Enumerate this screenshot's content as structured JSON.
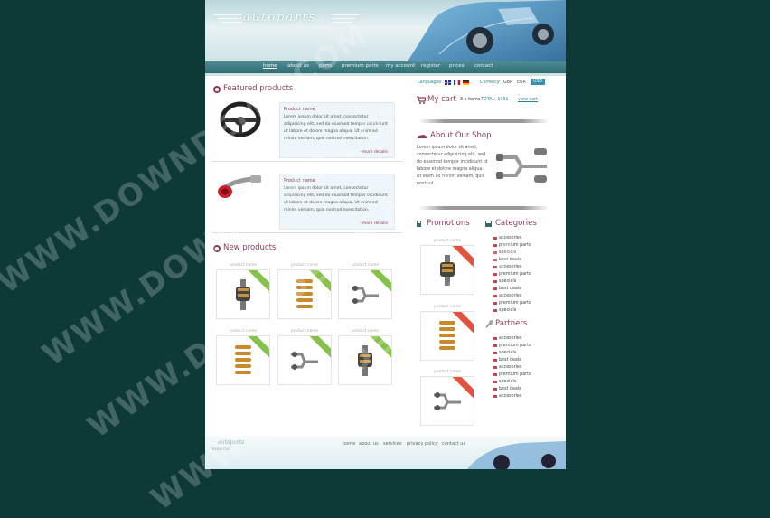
{
  "header": {
    "logo_text": "autoparts"
  },
  "nav": {
    "items": [
      "home",
      "about us",
      "parts",
      "premium parts",
      "my account",
      "register",
      "prices",
      "contact"
    ]
  },
  "featured": {
    "title": "Featured products",
    "products": [
      {
        "name": "Product name",
        "desc": "Lorem ipsum dolor sit amet, consectetur adipisicing elit, sed do eiusmod tempor incididunt ut labore et dolore magna aliqua. Ut enim ad minim veniam, quis nostrud exercitation.",
        "more": "- more details -"
      },
      {
        "name": "Product name",
        "desc": "Lorem ipsum dolor sit amet, consectetur adipisicing elit, sed do eiusmod tempor incididunt ut labore et dolore magna aliqua. Ut enim ad minim veniam, quis nostrud exercitation.",
        "more": "- more details -"
      }
    ]
  },
  "new_products": {
    "title": "New products",
    "items": [
      {
        "caption": "product name",
        "badge": "NEW",
        "icon": "coilover-icon"
      },
      {
        "caption": "product name",
        "badge": "NEW",
        "icon": "spring-icon"
      },
      {
        "caption": "product name",
        "badge": "NEW",
        "icon": "exhaust-icon"
      },
      {
        "caption": "product name",
        "badge": "NEW",
        "icon": "spring-icon"
      },
      {
        "caption": "product name",
        "badge": "NEW",
        "icon": "exhaust-icon"
      },
      {
        "caption": "product name",
        "badge": "NEW",
        "icon": "coilover-icon"
      }
    ]
  },
  "languages": {
    "label": "Languages:"
  },
  "currency": {
    "label": "Currency:",
    "options": [
      "GBP",
      "EUR",
      "USD"
    ],
    "selected": "USD"
  },
  "cart": {
    "title": "My cart",
    "items": "3 x items",
    "total": "TOTAL: 100$",
    "view": "view cart"
  },
  "about": {
    "title": "About Our Shop",
    "text": "Lorem ipsum dolor sit amet, consectetur adipisicing elit, sed do eiusmod tempor incididunt ut labore et dolore magna aliqua. Ut enim ad minim veniam, quis nostrud."
  },
  "promotions": {
    "title": "Promotions",
    "items": [
      {
        "caption": "product name",
        "icon": "coilover-icon"
      },
      {
        "caption": "product name",
        "icon": "spring-icon"
      },
      {
        "caption": "product name",
        "icon": "exhaust-icon"
      }
    ]
  },
  "categories": {
    "title": "Categories",
    "items": [
      "accesories",
      "premium parts",
      "specials",
      "best deals",
      "accesories",
      "premium parts",
      "specials",
      "best deals",
      "accesories",
      "premium parts",
      "specials"
    ]
  },
  "partners": {
    "title": "Partners",
    "items": [
      "accesories",
      "premium parts",
      "specials",
      "best deals",
      "accesories",
      "premium parts",
      "specials",
      "best deals",
      "accesories"
    ]
  },
  "footer": {
    "links": [
      "home",
      "about us",
      "services",
      "privacy policy",
      "contact us"
    ],
    "logo_text": "autoparts",
    "sub": "resources"
  },
  "watermark": {
    "text": "WWW.DOWNDEMO.COM"
  },
  "colors": {
    "background": "#0d3a37",
    "accent": "#8a3a5e",
    "nav": "#2f6c73",
    "new_badge": "#86c24a",
    "sale_badge": "#e2523c"
  }
}
